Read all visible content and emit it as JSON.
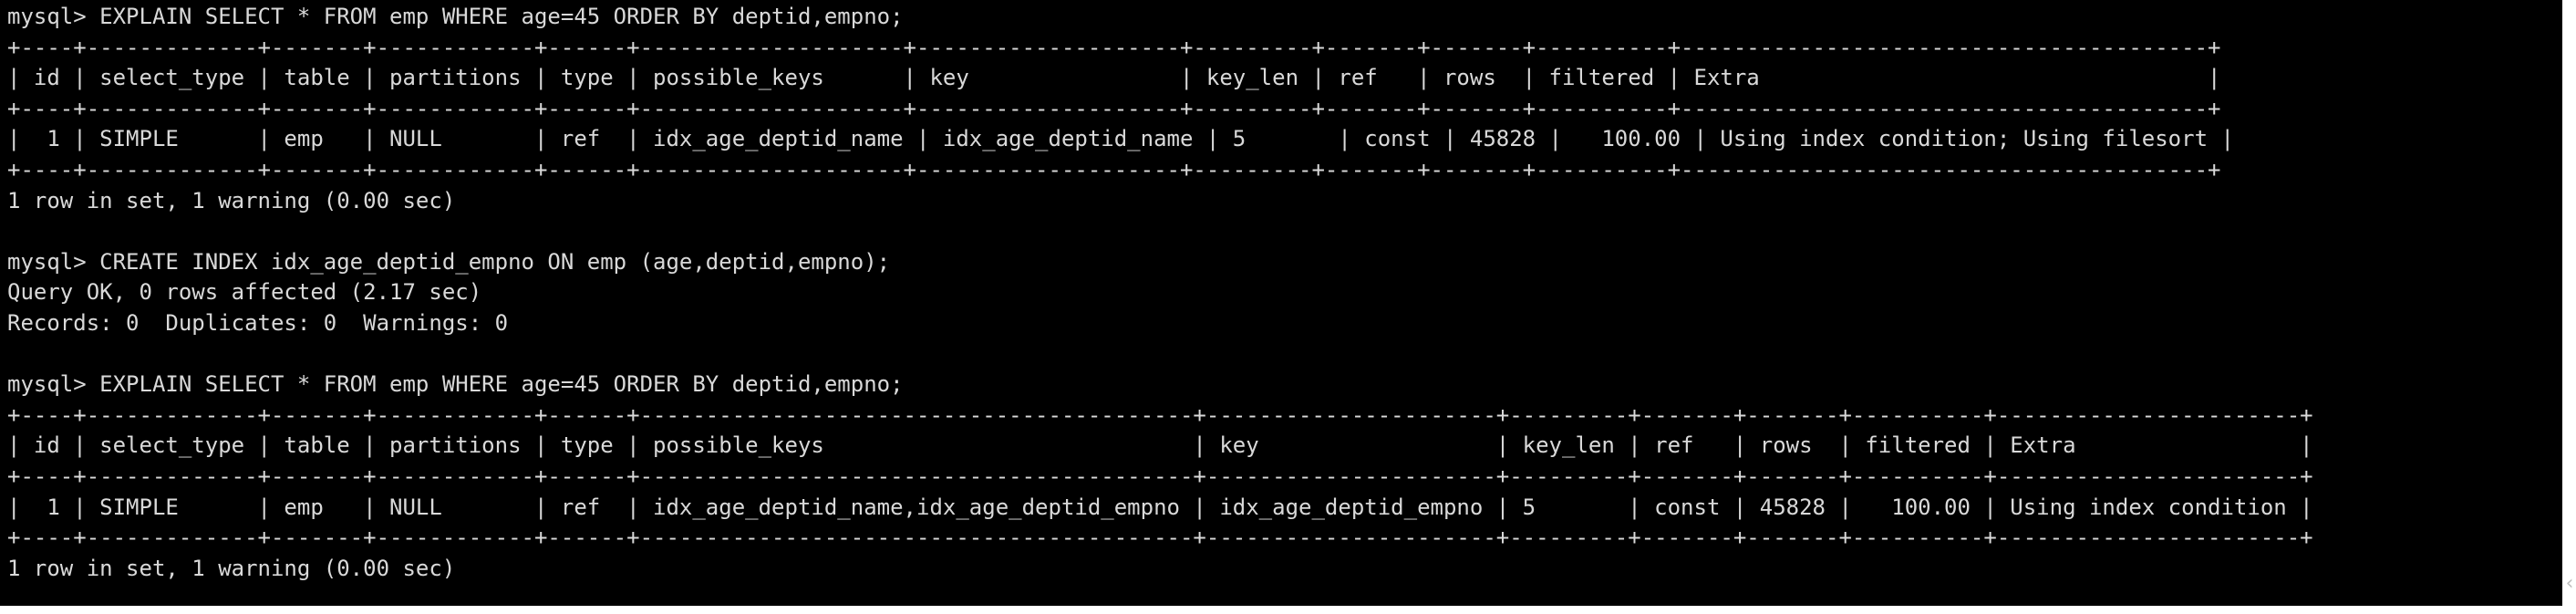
{
  "terminal": {
    "lines": [
      "mysql> EXPLAIN SELECT * FROM emp WHERE age=45 ORDER BY deptid,empno;",
      "+----+-------------+-------+------------+------+--------------------+--------------------+---------+-------+-------+----------+----------------------------------------+",
      "| id | select_type | table | partitions | type | possible_keys      | key                | key_len | ref   | rows  | filtered | Extra                                  |",
      "+----+-------------+-------+------------+------+--------------------+--------------------+---------+-------+-------+----------+----------------------------------------+",
      "|  1 | SIMPLE      | emp   | NULL       | ref  | idx_age_deptid_name | idx_age_deptid_name | 5       | const | 45828 |   100.00 | Using index condition; Using filesort |",
      "+----+-------------+-------+------------+------+--------------------+--------------------+---------+-------+-------+----------+----------------------------------------+",
      "1 row in set, 1 warning (0.00 sec)",
      "",
      "mysql> CREATE INDEX idx_age_deptid_empno ON emp (age,deptid,empno);",
      "Query OK, 0 rows affected (2.17 sec)",
      "Records: 0  Duplicates: 0  Warnings: 0",
      "",
      "mysql> EXPLAIN SELECT * FROM emp WHERE age=45 ORDER BY deptid,empno;",
      "+----+-------------+-------+------------+------+------------------------------------------+----------------------+---------+-------+-------+----------+-----------------------+",
      "| id | select_type | table | partitions | type | possible_keys                            | key                  | key_len | ref   | rows  | filtered | Extra                 |",
      "+----+-------------+-------+------------+------+------------------------------------------+----------------------+---------+-------+-------+----------+-----------------------+",
      "|  1 | SIMPLE      | emp   | NULL       | ref  | idx_age_deptid_name,idx_age_deptid_empno | idx_age_deptid_empno | 5       | const | 45828 |   100.00 | Using index condition |",
      "+----+-------------+-------+------------+------+------------------------------------------+----------------------+---------+-------+-------+----------+-----------------------+",
      "1 row in set, 1 warning (0.00 sec)"
    ],
    "scroll_grip_glyph": "‹"
  },
  "colors": {
    "background": "#000000",
    "text": "#d9d9d9"
  }
}
